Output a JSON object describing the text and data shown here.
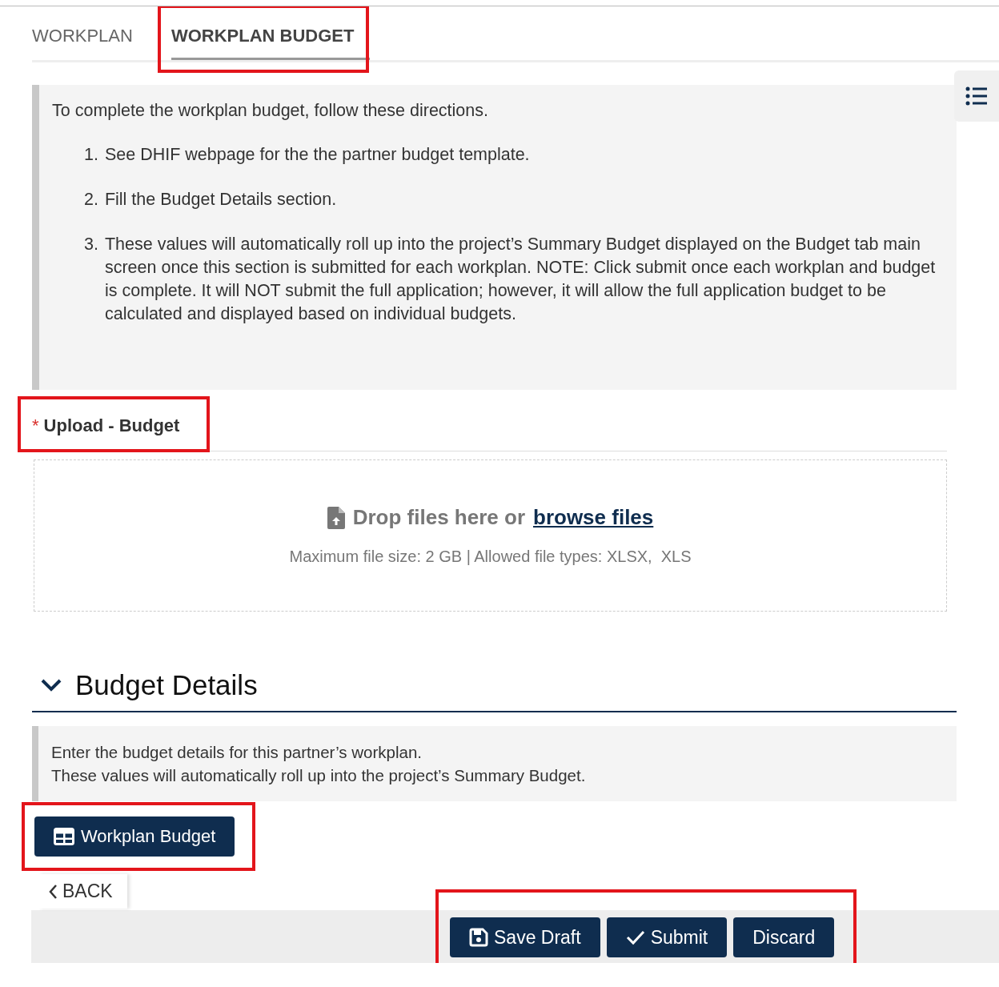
{
  "tabs": [
    {
      "label": "WORKPLAN",
      "selected": false,
      "highlighted": false
    },
    {
      "label": "WORKPLAN BUDGET",
      "selected": true,
      "highlighted": true
    }
  ],
  "instructions": {
    "intro": "To complete the workplan budget, follow these directions.",
    "steps": [
      {
        "number": "1.",
        "text": "See DHIF webpage for the the partner budget template."
      },
      {
        "number": "2.",
        "text": "Fill the Budget Details section."
      },
      {
        "number": "3.",
        "text": "These values will automatically roll up into the project’s Summary Budget displayed on the Budget tab main screen once this section is submitted for each workplan. NOTE: Click submit once each workplan and budget is complete. It will NOT submit the full application; however, it will allow the full application budget to be calculated and displayed based on individual budgets."
      }
    ]
  },
  "upload": {
    "label": "Upload - Budget",
    "required_mark": "*",
    "highlighted": true,
    "drop_text": "Drop files here or",
    "browse_link": "browse files",
    "limits": "Maximum file size: 2 GB | Allowed file types: XLSX,  XLS"
  },
  "budget_details": {
    "title": "Budget Details",
    "expanded": true,
    "note_lines": [
      "Enter the budget details for this partner’s workplan.",
      "These values will automatically roll up into the project’s Summary Budget."
    ],
    "button": {
      "label": "Workplan Budget",
      "highlighted": true
    }
  },
  "back_button": "BACK",
  "actions": {
    "highlighted": true,
    "buttons": [
      {
        "kind": "save",
        "label": "Save Draft"
      },
      {
        "kind": "submit",
        "label": "Submit"
      },
      {
        "kind": "discard",
        "label": "Discard"
      }
    ]
  }
}
